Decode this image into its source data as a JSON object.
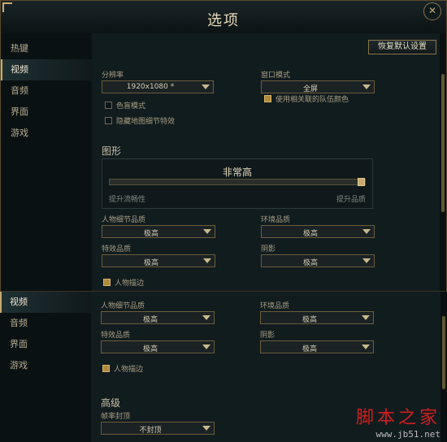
{
  "window": {
    "title": "选项",
    "close": "✕"
  },
  "sidebar": {
    "items": [
      {
        "label": "热键",
        "active": false
      },
      {
        "label": "视频",
        "active": true
      },
      {
        "label": "音频",
        "active": false
      },
      {
        "label": "界面",
        "active": false
      },
      {
        "label": "游戏",
        "active": false
      }
    ]
  },
  "header": {
    "restore_defaults": "恢复默认设置"
  },
  "display": {
    "resolution_label": "分辨率",
    "resolution_value": "1920x1080 *",
    "window_mode_label": "窗口模式",
    "window_mode_value": "全屏",
    "colorblind_label": "色盲模式",
    "colorblind_checked": false,
    "hide_eyecandy_label": "隐藏地图细节特效",
    "hide_eyecandy_checked": false,
    "team_color_label": "使用相关联的队伍颜色",
    "team_color_checked": true
  },
  "graphics": {
    "section_title": "图形",
    "quality_value": "非常高",
    "quality_level": 1.0,
    "slider_low": "提升流畅性",
    "slider_high": "提升品质",
    "character_quality_label": "人物细节品质",
    "character_quality_value": "极高",
    "environment_quality_label": "环境品质",
    "environment_quality_value": "极高",
    "effects_quality_label": "特效品质",
    "effects_quality_value": "极高",
    "shadows_label": "阴影",
    "shadows_value": "极高",
    "character_inking_label": "人物描边",
    "character_inking_checked": true
  },
  "panel2": {
    "sidebar": [
      "视频",
      "音频",
      "界面",
      "游戏"
    ],
    "advanced_title": "高级",
    "frame_rate_cap_label": "帧率封顶",
    "frame_rate_cap_value": "不封顶"
  },
  "watermark": {
    "main": "脚本之家",
    "sub": "www.jb51.net"
  },
  "colors": {
    "gold": "#c8aa6e",
    "bg": "#111c1f",
    "sidebar_bg": "#0a1113",
    "watermark": "#d01e1e"
  }
}
